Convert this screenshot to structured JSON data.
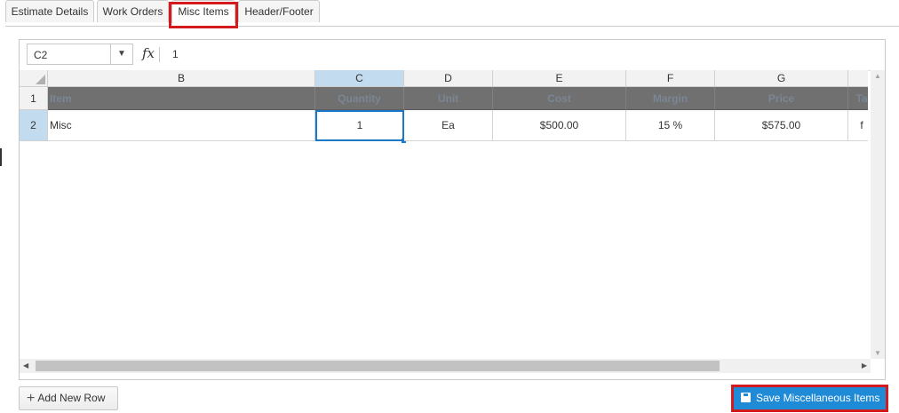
{
  "tabs": [
    {
      "label": "Estimate Details",
      "active": false
    },
    {
      "label": "Work Orders",
      "active": false
    },
    {
      "label": "Misc Items",
      "active": true
    },
    {
      "label": "Header/Footer",
      "active": false
    }
  ],
  "highlight_color": "#d21a1f",
  "formula_bar": {
    "name_box": "C2",
    "fx_label": "fx",
    "value": "1"
  },
  "sheet": {
    "columns": [
      "B",
      "C",
      "D",
      "E",
      "F",
      "G"
    ],
    "selected_column": "C",
    "rows": [
      "1",
      "2"
    ],
    "selected_row": "2",
    "header_row": [
      "Item",
      "Quantity",
      "Unit",
      "Cost",
      "Margin",
      "Price",
      "Ta"
    ],
    "data_row": [
      "Misc",
      "1",
      "Ea",
      "$500.00",
      "15 %",
      "$575.00",
      "f"
    ],
    "active_cell": "C2"
  },
  "buttons": {
    "add_row": "Add New Row",
    "save": "Save Miscellaneous Items"
  },
  "colors": {
    "accent": "#1f8ad6",
    "selection": "#c2dbee",
    "header_fill": "#707070"
  },
  "icons": {
    "dropdown": "chevron-down-icon",
    "plus": "plus-icon",
    "save": "save-icon"
  }
}
